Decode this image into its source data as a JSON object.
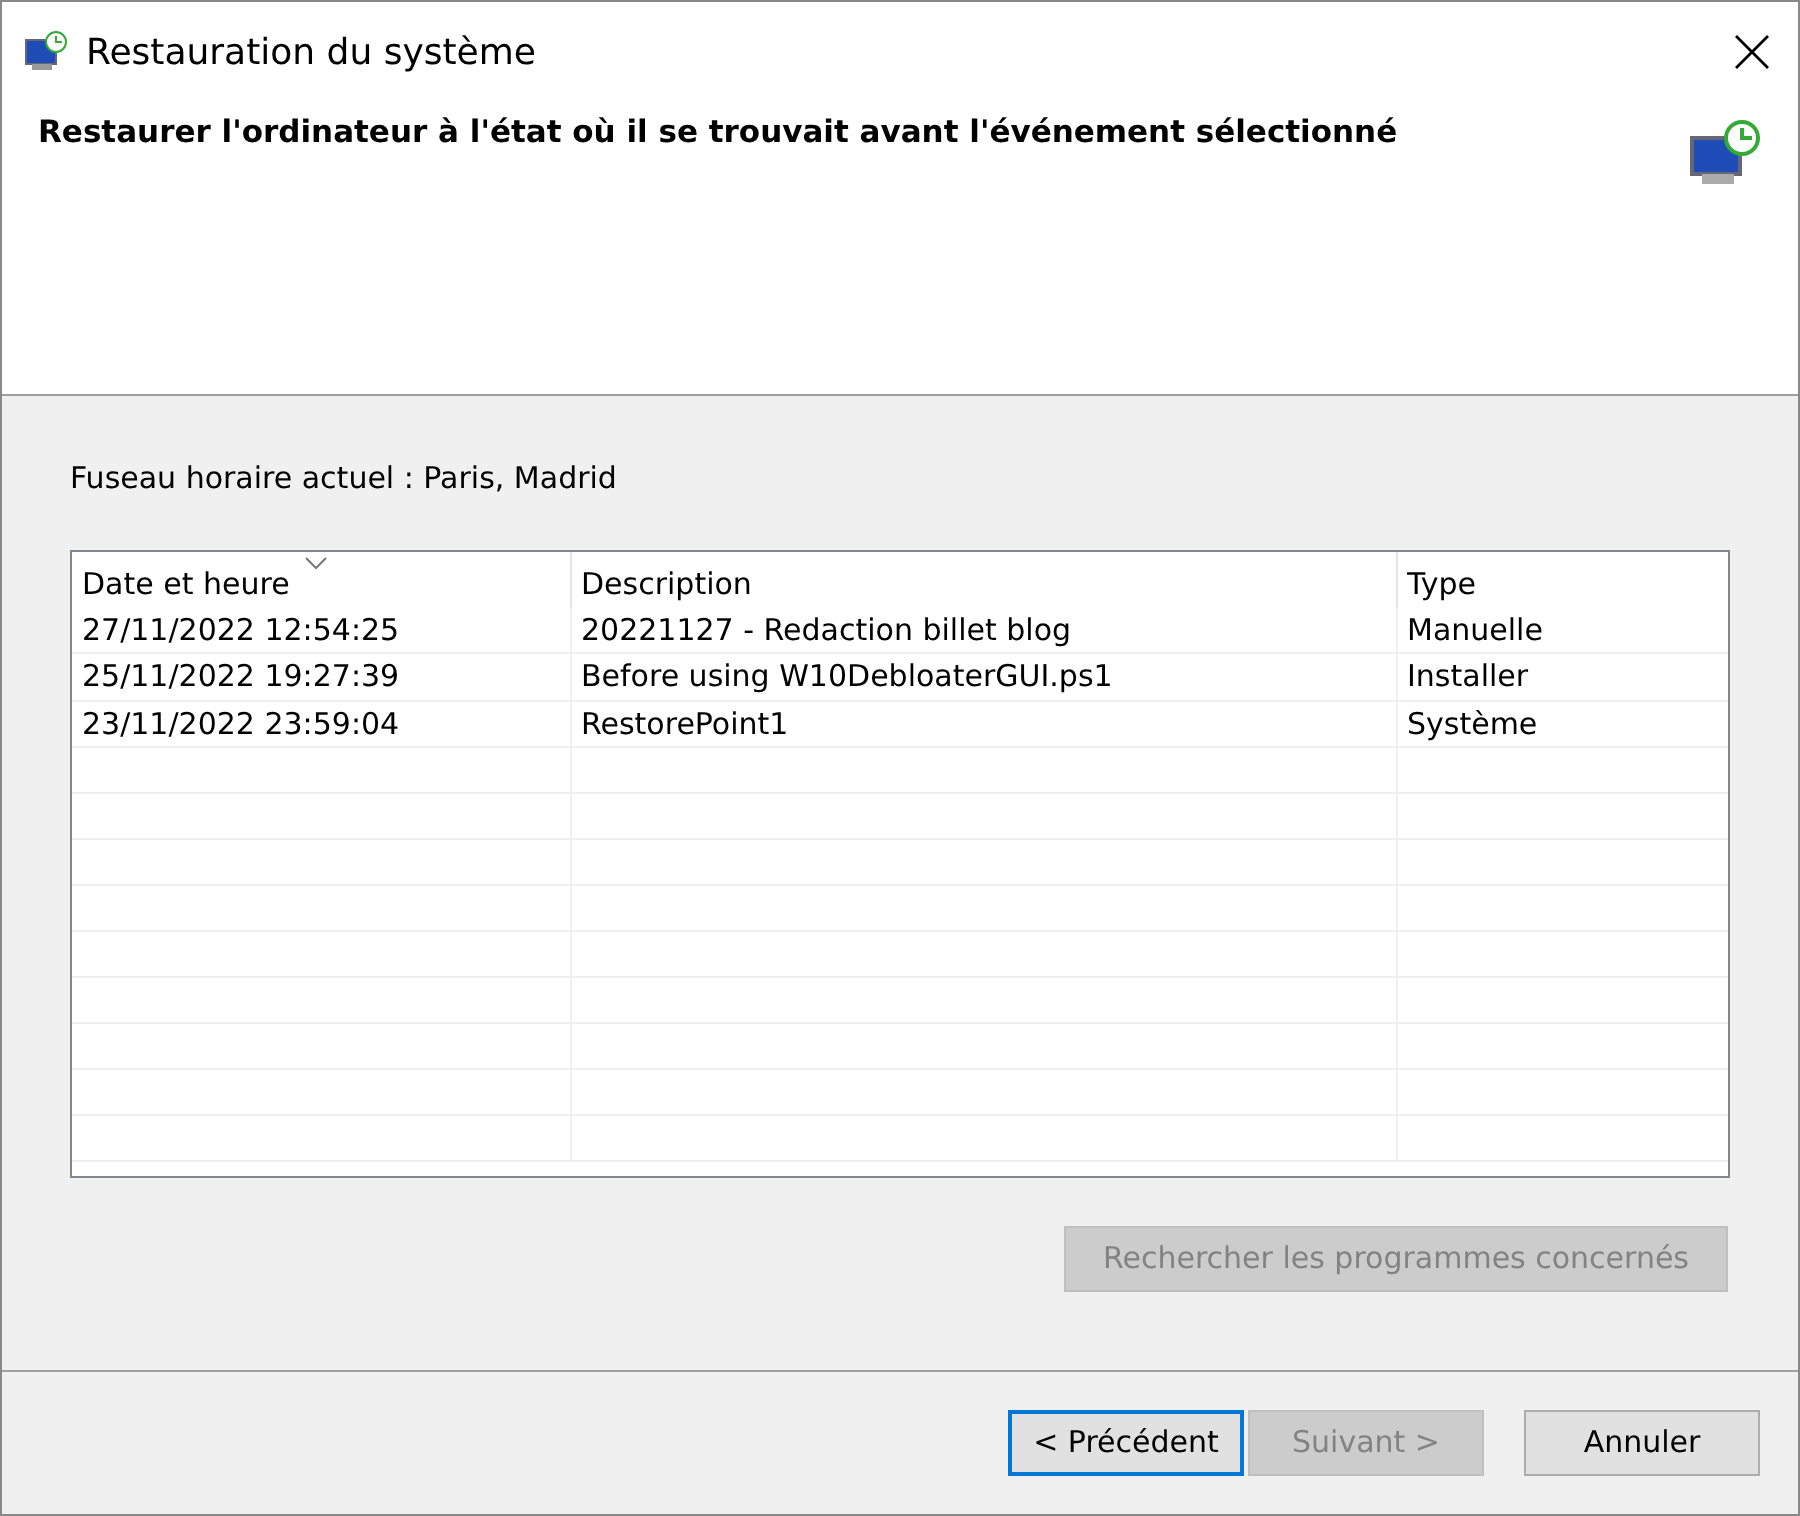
{
  "window": {
    "title": "Restauration du système"
  },
  "header": {
    "heading": "Restaurer l'ordinateur à l'état où il se trouvait avant l'événement sélectionné"
  },
  "timezone": "Fuseau horaire actuel : Paris, Madrid",
  "table": {
    "columns": [
      {
        "label": "Date et heure",
        "sorted": true
      },
      {
        "label": "Description",
        "sorted": false
      },
      {
        "label": "Type",
        "sorted": false
      }
    ],
    "rows": [
      [
        "27/11/2022 12:54:25",
        "20221127 - Redaction billet blog",
        "Manuelle"
      ],
      [
        "25/11/2022 19:27:39",
        "Before using W10DebloaterGUI.ps1",
        "Installer"
      ],
      [
        "23/11/2022 23:59:04",
        "RestorePoint1",
        "Système"
      ]
    ]
  },
  "scan_button": {
    "label": "Rechercher les programmes concernés",
    "disabled": true
  },
  "buttons": [
    {
      "label": "< Précédent",
      "disabled": false,
      "focused": true
    },
    {
      "label": "Suivant >",
      "disabled": true,
      "focused": false
    },
    {
      "label": "Annuler",
      "disabled": false,
      "focused": false
    }
  ]
}
